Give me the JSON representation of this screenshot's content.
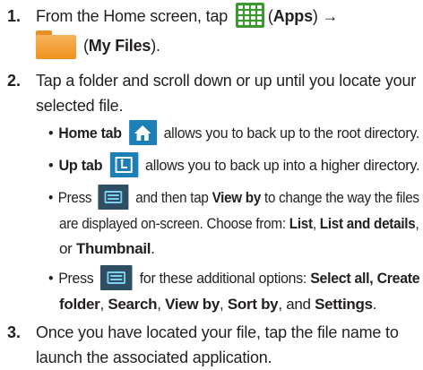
{
  "steps": [
    {
      "num": "1.",
      "l1_a": "From the Home screen, tap",
      "l1_b": "(",
      "l1_c": "Apps",
      "l1_d": ") →",
      "l2_a": "(",
      "l2_b": "My Files",
      "l2_c": ")."
    },
    {
      "num": "2.",
      "l1": "Tap a folder and scroll down or up until you locate your",
      "l2": "selected file.",
      "bullets": [
        {
          "bold": "Home tab",
          "text": "allows you to back up to the root directory."
        },
        {
          "bold": "Up tab",
          "text": "allows you to back up into a higher directory."
        },
        {
          "pre": "Press",
          "mid": "and then tap",
          "b1": "View by",
          "post": "to change the way the files",
          "l2_a": "are displayed on-screen. Choose from:",
          "l2_b": "List",
          "l2_c": ",",
          "l2_d": "List and details",
          "l2_e": ",",
          "l3_a": "or",
          "l3_b": "Thumbnail",
          "l3_c": "."
        },
        {
          "pre": "Press",
          "mid": "for these additional options:",
          "b1": "Select all, Create",
          "l2_a": "folder",
          "l2_b": ",",
          "l2_c": "Search",
          "l2_d": ",",
          "l2_e": "View by",
          "l2_f": ",",
          "l2_g": "Sort by",
          "l2_h": ", and",
          "l2_i": "Settings",
          "l2_j": "."
        }
      ]
    },
    {
      "num": "3.",
      "l1": "Once you have located your file, tap the file name to",
      "l2": "launch the associated application."
    }
  ],
  "icons": {
    "apps": "apps-grid-icon",
    "folder": "folder-icon",
    "home": "home-icon",
    "up": "up-directory-icon",
    "menu": "menu-icon"
  },
  "colors": {
    "apps_green": "#3a9a2e",
    "folder_orange": "#f0921e",
    "tab_blue": "#1c7fb6",
    "menu_dark": "#2d4e63"
  }
}
